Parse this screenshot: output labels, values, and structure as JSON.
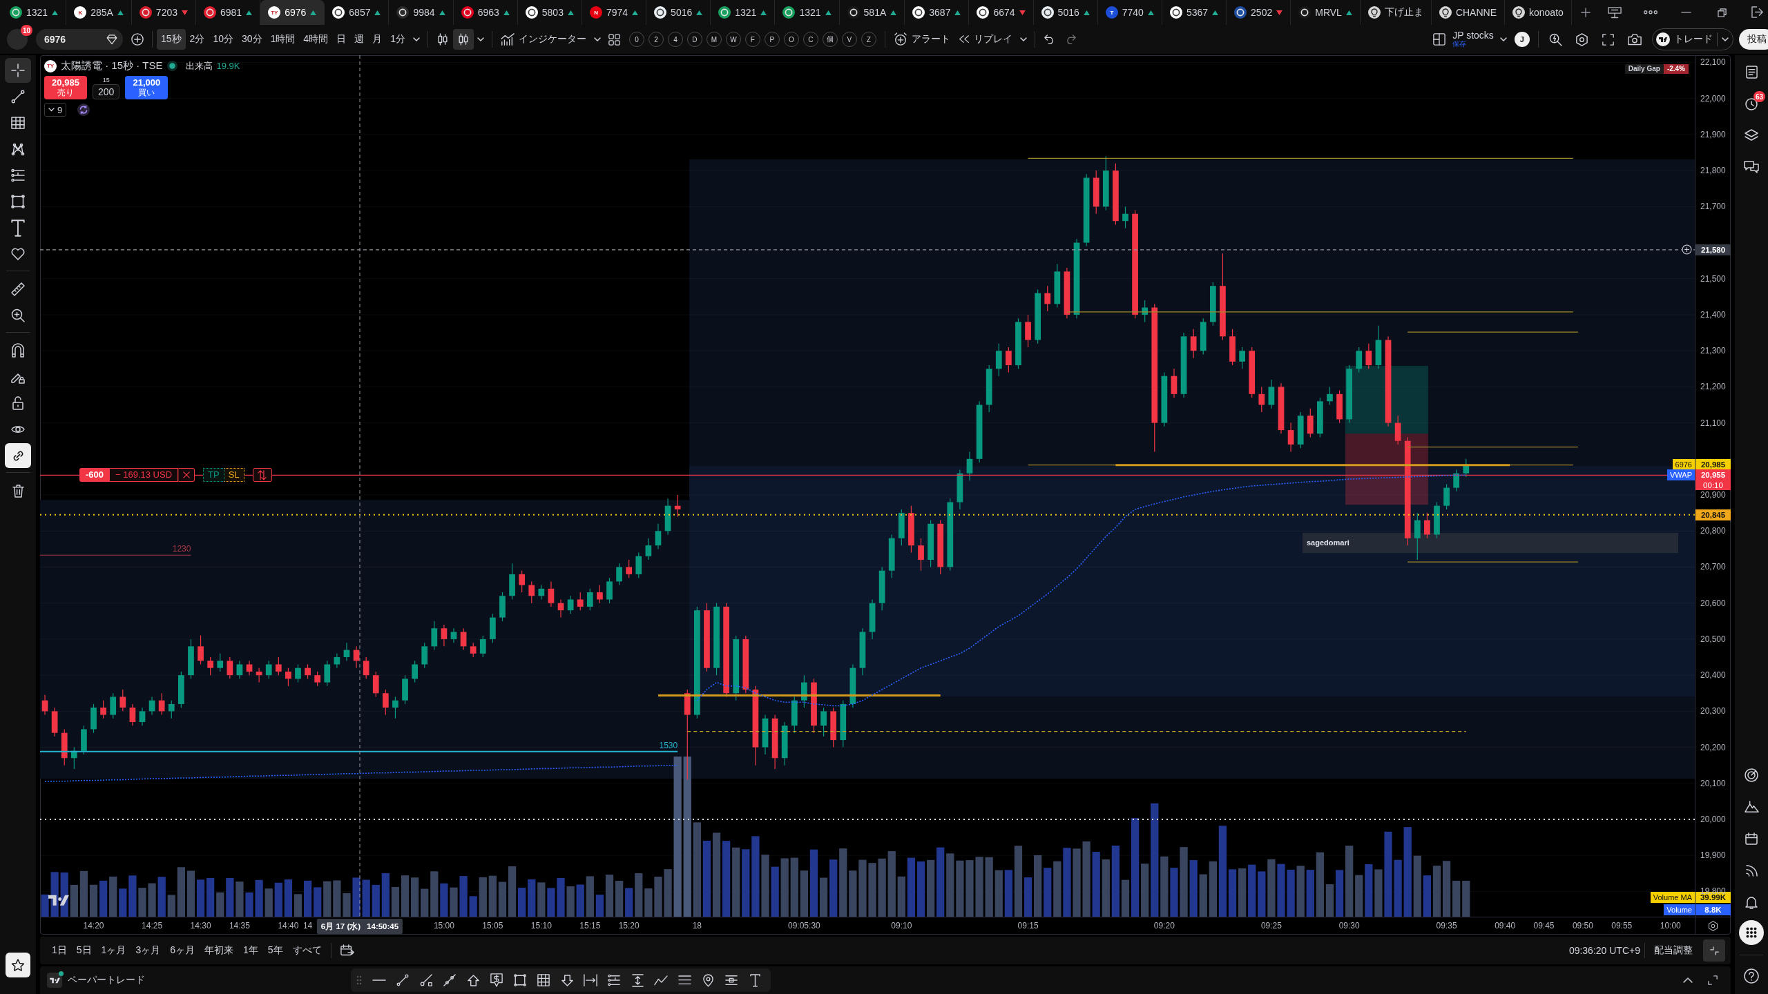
{
  "tabs": [
    {
      "kind": "symbol",
      "label": "1321",
      "rising": true,
      "color": "#18a05e",
      "selected": false
    },
    {
      "kind": "symbol",
      "label": "285A",
      "rising": true,
      "color": "#ffffff",
      "logo": "K",
      "selected": false
    },
    {
      "kind": "symbol",
      "label": "7203",
      "rising": false,
      "color": "#d81e2c",
      "selected": false
    },
    {
      "kind": "symbol",
      "label": "6981",
      "rising": true,
      "color": "#e0202f",
      "selected": false
    },
    {
      "kind": "symbol",
      "label": "6976",
      "rising": true,
      "color": "#ffffff",
      "logo": "TY",
      "selected": true
    },
    {
      "kind": "symbol",
      "label": "6857",
      "rising": true,
      "color": "#ffffff",
      "selected": false
    },
    {
      "kind": "symbol",
      "label": "9984",
      "rising": true,
      "color": "#2b2b2b",
      "selected": false
    },
    {
      "kind": "symbol",
      "label": "6963",
      "rising": true,
      "color": "#e00020",
      "selected": false
    },
    {
      "kind": "symbol",
      "label": "5803",
      "rising": true,
      "color": "#ffffff",
      "selected": false
    },
    {
      "kind": "symbol",
      "label": "7974",
      "rising": true,
      "color": "#e60012",
      "logo": "N",
      "selected": false
    },
    {
      "kind": "symbol",
      "label": "5016",
      "rising": true,
      "color": "#e8eef2",
      "selected": false
    },
    {
      "kind": "symbol",
      "label": "1321",
      "rising": true,
      "color": "#18a05e",
      "selected": false
    },
    {
      "kind": "symbol",
      "label": "1321",
      "rising": true,
      "color": "#18a05e",
      "selected": false
    },
    {
      "kind": "symbol",
      "label": "581A",
      "rising": true,
      "color": "#1a1a1a",
      "selected": false
    },
    {
      "kind": "symbol",
      "label": "3687",
      "rising": true,
      "color": "#ffffff",
      "selected": false
    },
    {
      "kind": "symbol",
      "label": "6674",
      "rising": false,
      "color": "#ffffff",
      "selected": false
    },
    {
      "kind": "symbol",
      "label": "5016",
      "rising": true,
      "color": "#e8eef2",
      "selected": false
    },
    {
      "kind": "symbol",
      "label": "7740",
      "rising": true,
      "color": "#1d4ed8",
      "logo": "T",
      "selected": false
    },
    {
      "kind": "symbol",
      "label": "5367",
      "rising": true,
      "color": "#ffffff",
      "selected": false
    },
    {
      "kind": "symbol",
      "label": "2502",
      "rising": false,
      "color": "#1f4fa0",
      "selected": false
    },
    {
      "kind": "symbol",
      "label": "MRVL",
      "rising": true,
      "color": "#1a1a1a",
      "selected": false
    },
    {
      "kind": "idea",
      "label": "下げ止ま",
      "selected": false
    },
    {
      "kind": "idea",
      "label": "CHANNE",
      "selected": false
    },
    {
      "kind": "idea",
      "label": "konoato",
      "selected": false
    }
  ],
  "toolbar": {
    "account_badge": "10",
    "symbol": "6976",
    "intervals": [
      {
        "label": "15秒",
        "selected": true
      },
      {
        "label": "2分",
        "selected": false
      },
      {
        "label": "10分",
        "selected": false
      },
      {
        "label": "30分",
        "selected": false
      },
      {
        "label": "1時間",
        "selected": false
      },
      {
        "label": "4時間",
        "selected": false
      },
      {
        "label": "日",
        "selected": false
      },
      {
        "label": "週",
        "selected": false
      },
      {
        "label": "月",
        "selected": false
      },
      {
        "label": "1分",
        "selected": false
      }
    ],
    "chart_types": [
      {
        "selected": false
      },
      {
        "selected": true
      }
    ],
    "indicators": "インジケーター",
    "quick_buttons": [
      "0",
      "2",
      "4",
      "D",
      "M",
      "W",
      "F",
      "P",
      "O",
      "C",
      "個",
      "V",
      "Z"
    ],
    "alert": "アラート",
    "replay": "リプレイ",
    "layout": {
      "name": "JP stocks",
      "status": "保存",
      "avatar": "J"
    },
    "trade": "トレード",
    "publish": "投稿"
  },
  "left_toolbar": {
    "drawing_tools": [
      {
        "selected": true
      },
      {
        "selected": false
      },
      {
        "selected": false
      },
      {
        "selected": false
      },
      {
        "selected": false
      },
      {
        "selected": false
      },
      {
        "selected": false
      },
      {
        "selected": false
      }
    ],
    "measure_tools": [
      {
        "selected": false
      },
      {
        "selected": false
      }
    ],
    "toggles": [
      {
        "on": false
      },
      {
        "on": false
      },
      {
        "on": false
      },
      {
        "on": false
      },
      {
        "on": true
      }
    ]
  },
  "right_sidebar": {
    "alerts_badge": "63",
    "top_panels": [
      {
        "selected": false
      },
      {
        "selected": false
      },
      {
        "selected": false
      },
      {
        "selected": false
      }
    ],
    "bottom_panels": [
      {
        "selected": false
      },
      {
        "selected": false
      },
      {
        "selected": false
      },
      {
        "selected": false
      },
      {
        "selected": false
      },
      {
        "selected": true
      }
    ]
  },
  "chart": {
    "legend": {
      "logo": "TY",
      "title": "太陽誘電 · 15秒 · TSE",
      "volume_label": "出来高",
      "volume_value": "19.9K"
    },
    "trade_buttons": {
      "sell_price": "20,985",
      "sell_label": "売り",
      "step": "15",
      "quantity": "200",
      "buy_price": "21,000",
      "buy_label": "買い"
    },
    "indicator_toggle": "9",
    "daily_gap": {
      "label": "Daily Gap",
      "value": "-2.4%"
    },
    "position": {
      "quantity": "-600",
      "pnl": "− 169.13 USD",
      "take_profit": "TP",
      "stop_loss": "SL"
    },
    "zone_label": "sagedomari",
    "level_labels": [
      "1230",
      "1530"
    ],
    "price_badges": [
      {
        "kind": "last",
        "tag": "6976",
        "price": "20,985"
      },
      {
        "kind": "vwap",
        "price": "20,955",
        "countdown": "00:10"
      },
      {
        "kind": "line",
        "price": "20,845"
      }
    ],
    "crosshair": {
      "date": "6月 17 (水)",
      "time": "14:50:45"
    },
    "volume_badges": [
      {
        "tag": "Volume MA",
        "value": "39.99K"
      },
      {
        "tag": "Volume",
        "value": "8.8K"
      }
    ],
    "chart_data": {
      "type": "candlestick",
      "grid": true,
      "ylim": [
        19730,
        22120
      ],
      "yticks": [
        {
          "value": 19800,
          "label": "19,800"
        },
        {
          "value": 19900,
          "label": "19,900"
        },
        {
          "value": 20000,
          "label": "20,000"
        },
        {
          "value": 20100,
          "label": "20,100"
        },
        {
          "value": 20200,
          "label": "20,200"
        },
        {
          "value": 20300,
          "label": "20,300"
        },
        {
          "value": 20400,
          "label": "20,400"
        },
        {
          "value": 20500,
          "label": "20,500"
        },
        {
          "value": 20600,
          "label": "20,600"
        },
        {
          "value": 20700,
          "label": "20,700"
        },
        {
          "value": 20800,
          "label": "20,800"
        },
        {
          "value": 20900,
          "label": "20,900"
        },
        {
          "value": 21100,
          "label": "21,100"
        },
        {
          "value": 21200,
          "label": "21,200"
        },
        {
          "value": 21300,
          "label": "21,300"
        },
        {
          "value": 21400,
          "label": "21,400"
        },
        {
          "value": 21500,
          "label": "21,500"
        },
        {
          "value": 21700,
          "label": "21,700"
        },
        {
          "value": 21800,
          "label": "21,800"
        },
        {
          "value": 21900,
          "label": "21,900"
        },
        {
          "value": 22000,
          "label": "22,000"
        },
        {
          "value": 22100,
          "label": "22,100"
        }
      ],
      "categories": [
        null,
        null,
        null,
        null,
        null,
        "14:20",
        null,
        null,
        null,
        null,
        null,
        "14:25",
        null,
        null,
        null,
        null,
        "14:30",
        null,
        null,
        null,
        "14:35",
        null,
        null,
        null,
        null,
        "14:40",
        null,
        "14",
        null,
        null,
        null,
        null,
        null,
        null,
        null,
        null,
        null,
        null,
        null,
        null,
        null,
        "15:00",
        null,
        null,
        null,
        null,
        "15:05",
        null,
        null,
        null,
        null,
        "15:10",
        null,
        null,
        null,
        null,
        "15:15",
        null,
        null,
        null,
        "15:20",
        null,
        null,
        null,
        null,
        null,
        null,
        "18",
        null,
        null,
        null,
        null,
        null,
        null,
        null,
        null,
        null,
        null,
        "09:05:30",
        null,
        null,
        null,
        null,
        null,
        null,
        null,
        null,
        null,
        "09:10",
        null,
        null,
        null,
        null,
        null,
        null,
        null,
        null,
        null,
        null,
        null,
        null,
        "09:15",
        null,
        null,
        null,
        null,
        null,
        null,
        null,
        null,
        null,
        null,
        null,
        null,
        null,
        "09:20",
        null,
        null,
        null,
        null,
        null,
        null,
        null,
        null,
        null,
        null,
        "09:25",
        null,
        null,
        null,
        null,
        null,
        null,
        null,
        "09:30",
        null,
        null,
        null,
        null,
        null,
        null,
        null,
        null,
        null,
        "09:35",
        null,
        null,
        null,
        null,
        null,
        "09:40",
        null,
        null,
        null,
        "09:45",
        null,
        null,
        null,
        "09:50",
        null,
        null,
        null,
        "09:55",
        null,
        null,
        null,
        null,
        "10:00",
        null,
        null
      ],
      "ohlc": [
        [
          20330,
          20345,
          20290,
          20300
        ],
        [
          20300,
          20310,
          20230,
          20240
        ],
        [
          20240,
          20250,
          20150,
          20170
        ],
        [
          20170,
          20200,
          20140,
          20190
        ],
        [
          20190,
          20260,
          20180,
          20250
        ],
        [
          20250,
          20320,
          20240,
          20310
        ],
        [
          20310,
          20330,
          20280,
          20290
        ],
        [
          20290,
          20350,
          20280,
          20340
        ],
        [
          20340,
          20360,
          20300,
          20310
        ],
        [
          20310,
          20320,
          20260,
          20270
        ],
        [
          20270,
          20310,
          20260,
          20300
        ],
        [
          20300,
          20340,
          20290,
          20330
        ],
        [
          20330,
          20350,
          20290,
          20300
        ],
        [
          20300,
          20330,
          20280,
          20320
        ],
        [
          20320,
          20410,
          20310,
          20400
        ],
        [
          20400,
          20500,
          20390,
          20480
        ],
        [
          20480,
          20510,
          20430,
          20440
        ],
        [
          20440,
          20450,
          20400,
          20420
        ],
        [
          20420,
          20460,
          20410,
          20440
        ],
        [
          20440,
          20450,
          20390,
          20400
        ],
        [
          20400,
          20440,
          20390,
          20430
        ],
        [
          20430,
          20440,
          20400,
          20410
        ],
        [
          20410,
          20420,
          20380,
          20400
        ],
        [
          20400,
          20440,
          20390,
          20430
        ],
        [
          20430,
          20450,
          20400,
          20410
        ],
        [
          20410,
          20420,
          20370,
          20390
        ],
        [
          20390,
          20430,
          20380,
          20420
        ],
        [
          20420,
          20430,
          20390,
          20400
        ],
        [
          20400,
          20410,
          20370,
          20380
        ],
        [
          20380,
          20440,
          20370,
          20430
        ],
        [
          20430,
          20460,
          20420,
          20450
        ],
        [
          20450,
          20490,
          20440,
          20470
        ],
        [
          20470,
          20480,
          20420,
          20440
        ],
        [
          20440,
          20450,
          20390,
          20400
        ],
        [
          20400,
          20410,
          20340,
          20350
        ],
        [
          20350,
          20360,
          20290,
          20310
        ],
        [
          20310,
          20340,
          20280,
          20330
        ],
        [
          20330,
          20400,
          20320,
          20390
        ],
        [
          20390,
          20440,
          20380,
          20430
        ],
        [
          20430,
          20490,
          20420,
          20480
        ],
        [
          20480,
          20550,
          20470,
          20530
        ],
        [
          20530,
          20540,
          20480,
          20500
        ],
        [
          20500,
          20530,
          20490,
          20520
        ],
        [
          20520,
          20530,
          20470,
          20480
        ],
        [
          20480,
          20490,
          20450,
          20460
        ],
        [
          20460,
          20510,
          20450,
          20500
        ],
        [
          20500,
          20570,
          20490,
          20560
        ],
        [
          20560,
          20630,
          20550,
          20620
        ],
        [
          20620,
          20710,
          20610,
          20680
        ],
        [
          20680,
          20690,
          20630,
          20650
        ],
        [
          20650,
          20660,
          20600,
          20620
        ],
        [
          20620,
          20650,
          20610,
          20640
        ],
        [
          20640,
          20660,
          20590,
          20600
        ],
        [
          20600,
          20610,
          20560,
          20580
        ],
        [
          20580,
          20620,
          20570,
          20610
        ],
        [
          20610,
          20630,
          20580,
          20590
        ],
        [
          20590,
          20640,
          20580,
          20630
        ],
        [
          20630,
          20650,
          20600,
          20610
        ],
        [
          20610,
          20670,
          20600,
          20660
        ],
        [
          20660,
          20710,
          20650,
          20700
        ],
        [
          20700,
          20720,
          20670,
          20680
        ],
        [
          20680,
          20740,
          20670,
          20730
        ],
        [
          20730,
          20780,
          20720,
          20760
        ],
        [
          20760,
          20820,
          20750,
          20800
        ],
        [
          20800,
          20890,
          20790,
          20870
        ],
        [
          20870,
          20900,
          20840,
          20860
        ],
        [
          20350,
          20360,
          20110,
          20290
        ],
        [
          20290,
          20590,
          20280,
          20580
        ],
        [
          20580,
          20600,
          20410,
          20420
        ],
        [
          20420,
          20600,
          20400,
          20590
        ],
        [
          20590,
          20600,
          20340,
          20350
        ],
        [
          20350,
          20510,
          20330,
          20500
        ],
        [
          20500,
          20510,
          20350,
          20360
        ],
        [
          20360,
          20370,
          20150,
          20200
        ],
        [
          20200,
          20290,
          20180,
          20280
        ],
        [
          20280,
          20290,
          20140,
          20170
        ],
        [
          20170,
          20270,
          20150,
          20260
        ],
        [
          20260,
          20340,
          20240,
          20330
        ],
        [
          20330,
          20400,
          20310,
          20380
        ],
        [
          20380,
          20390,
          20240,
          20260
        ],
        [
          20260,
          20310,
          20230,
          20300
        ],
        [
          20300,
          20310,
          20200,
          20220
        ],
        [
          20220,
          20330,
          20200,
          20320
        ],
        [
          20320,
          20430,
          20310,
          20420
        ],
        [
          20420,
          20530,
          20400,
          20520
        ],
        [
          20520,
          20610,
          20500,
          20600
        ],
        [
          20600,
          20700,
          20580,
          20690
        ],
        [
          20690,
          20790,
          20670,
          20780
        ],
        [
          20780,
          20860,
          20760,
          20850
        ],
        [
          20850,
          20870,
          20740,
          20760
        ],
        [
          20760,
          20780,
          20690,
          20720
        ],
        [
          20720,
          20830,
          20700,
          20820
        ],
        [
          20820,
          20830,
          20680,
          20700
        ],
        [
          20700,
          20890,
          20690,
          20880
        ],
        [
          20880,
          20970,
          20860,
          20960
        ],
        [
          20960,
          21020,
          20940,
          21000
        ],
        [
          21000,
          21160,
          20990,
          21150
        ],
        [
          21150,
          21260,
          21130,
          21250
        ],
        [
          21250,
          21320,
          21230,
          21300
        ],
        [
          21300,
          21310,
          21240,
          21260
        ],
        [
          21260,
          21390,
          21250,
          21380
        ],
        [
          21380,
          21400,
          21310,
          21330
        ],
        [
          21330,
          21470,
          21320,
          21460
        ],
        [
          21460,
          21480,
          21410,
          21430
        ],
        [
          21430,
          21540,
          21420,
          21520
        ],
        [
          21520,
          21530,
          21390,
          21400
        ],
        [
          21400,
          21610,
          21390,
          21600
        ],
        [
          21600,
          21790,
          21590,
          21780
        ],
        [
          21780,
          21800,
          21680,
          21700
        ],
        [
          21700,
          21840,
          21690,
          21800
        ],
        [
          21800,
          21820,
          21650,
          21660
        ],
        [
          21660,
          21700,
          21640,
          21680
        ],
        [
          21680,
          21690,
          21390,
          21400
        ],
        [
          21400,
          21440,
          21380,
          21420
        ],
        [
          21420,
          21430,
          21020,
          21100
        ],
        [
          21100,
          21240,
          21090,
          21230
        ],
        [
          21230,
          21250,
          21170,
          21180
        ],
        [
          21180,
          21350,
          21170,
          21340
        ],
        [
          21340,
          21360,
          21280,
          21300
        ],
        [
          21300,
          21390,
          21290,
          21380
        ],
        [
          21380,
          21490,
          21370,
          21480
        ],
        [
          21480,
          21570,
          21330,
          21340
        ],
        [
          21340,
          21360,
          21260,
          21270
        ],
        [
          21270,
          21310,
          21250,
          21300
        ],
        [
          21300,
          21310,
          21170,
          21180
        ],
        [
          21180,
          21200,
          21130,
          21150
        ],
        [
          21150,
          21220,
          21140,
          21200
        ],
        [
          21200,
          21210,
          21070,
          21080
        ],
        [
          21080,
          21100,
          21020,
          21040
        ],
        [
          21040,
          21130,
          21030,
          21120
        ],
        [
          21120,
          21140,
          21060,
          21070
        ],
        [
          21070,
          21170,
          21060,
          21160
        ],
        [
          21160,
          21200,
          21150,
          21180
        ],
        [
          21180,
          21190,
          21100,
          21110
        ],
        [
          21110,
          21260,
          21100,
          21250
        ],
        [
          21250,
          21310,
          21240,
          21300
        ],
        [
          21300,
          21320,
          21250,
          21260
        ],
        [
          21260,
          21370,
          21250,
          21330
        ],
        [
          21330,
          21340,
          21090,
          21100
        ],
        [
          21100,
          21120,
          21040,
          21050
        ],
        [
          21050,
          21060,
          20760,
          20780
        ],
        [
          20780,
          20850,
          20720,
          20830
        ],
        [
          20830,
          20850,
          20780,
          20790
        ],
        [
          20790,
          20880,
          20780,
          20870
        ],
        [
          20870,
          20930,
          20860,
          20920
        ],
        [
          20920,
          20970,
          20910,
          20960
        ],
        [
          20960,
          21000,
          20950,
          20985
        ],
        null,
        null,
        null,
        null,
        null,
        null,
        null,
        null,
        null,
        null,
        null,
        null,
        null,
        null,
        null,
        null,
        null,
        null,
        null,
        null,
        null,
        null,
        null
      ],
      "series": [
        {
          "name": "VWAP",
          "type": "line",
          "color": "#2962ff",
          "line_style": "dotted",
          "values": [
            20105,
            20106,
            20106,
            20107,
            20108,
            20108,
            20109,
            20110,
            20110,
            20111,
            20112,
            20113,
            20113,
            20114,
            20115,
            20115,
            20116,
            20117,
            20117,
            20118,
            20119,
            20120,
            20120,
            20121,
            20122,
            20122,
            20123,
            20124,
            20124,
            20125,
            20126,
            20127,
            20127,
            20128,
            20129,
            20129,
            20130,
            20131,
            20131,
            20132,
            20133,
            20134,
            20134,
            20135,
            20136,
            20136,
            20137,
            20138,
            20138,
            20139,
            20140,
            20141,
            20141,
            20142,
            20143,
            20143,
            20144,
            20145,
            20145,
            20146,
            20147,
            20148,
            20148,
            20149,
            20150,
            20150,
            null,
            20330,
            20360,
            20380,
            20370,
            20370,
            20365,
            20350,
            20340,
            20330,
            20325,
            20325,
            20325,
            20320,
            20318,
            20315,
            20315,
            20320,
            20330,
            20345,
            20360,
            20375,
            20390,
            20405,
            20420,
            20430,
            20440,
            20450,
            20460,
            20475,
            20495,
            20515,
            20535,
            20550,
            20565,
            20585,
            20605,
            20625,
            20648,
            20670,
            20695,
            20725,
            20755,
            20785,
            20810,
            20840,
            20860,
            20868,
            20875,
            20882,
            20888,
            20895,
            20900,
            20905,
            20910,
            20914,
            20918,
            20922,
            20925,
            20927,
            20929,
            20931,
            20933,
            20935,
            20937,
            20938,
            20940,
            20942,
            20944,
            20945,
            20946,
            20947,
            20948,
            20949,
            20950,
            20951,
            20952,
            20953,
            20954,
            20955,
            20955,
            null,
            null,
            null,
            null,
            null,
            null,
            null,
            null,
            null,
            null,
            null,
            null,
            null,
            null,
            null,
            null,
            null,
            null,
            null,
            null,
            null,
            null,
            null
          ]
        }
      ],
      "ref_lines": [
        {
          "axis": "y",
          "value": 20955,
          "color": "#f23645",
          "line_style": "solid"
        },
        {
          "axis": "y",
          "value": 20845,
          "color": "#f5c518",
          "line_style": "dotted"
        },
        {
          "axis": "y",
          "value": 20000,
          "color": "#e0e3eb",
          "line_style": "dotted"
        },
        {
          "axis": "y",
          "value": 21580,
          "label": "21,580",
          "color": "#9598a1",
          "line_style": "dashed"
        },
        {
          "axis": "y",
          "value": 21834,
          "color": "#a08a2a",
          "line_style": "solid"
        },
        {
          "axis": "y",
          "value": 21408,
          "color": "#a08a2a",
          "line_style": "solid"
        },
        {
          "axis": "y",
          "value": 21352,
          "color": "#a08a2a",
          "line_style": "solid"
        },
        {
          "axis": "y",
          "value": 21033,
          "color": "#a08a2a",
          "line_style": "solid"
        },
        {
          "axis": "y",
          "value": 20983,
          "color": "#a08a2a",
          "line_style": "solid"
        },
        {
          "axis": "y",
          "value": 20983,
          "color": "#d39a1c",
          "line_style": "solid"
        },
        {
          "axis": "y",
          "value": 20714,
          "color": "#a08a2a",
          "line_style": "solid"
        },
        {
          "axis": "y",
          "value": 20344,
          "color": "#d39a1c",
          "line_style": "solid"
        },
        {
          "axis": "y",
          "value": 20244,
          "color": "#c9a227",
          "line_style": "dashed"
        },
        {
          "axis": "y",
          "value": 20733,
          "color": "#a83a44",
          "line_style": "solid"
        },
        {
          "axis": "y",
          "value": 20188,
          "color": "#26b5d0",
          "line_style": "solid"
        }
      ]
    }
  },
  "range_bar": {
    "ranges": [
      "1日",
      "5日",
      "1ヶ月",
      "3ヶ月",
      "6ヶ月",
      "年初来",
      "1年",
      "5年",
      "すべて"
    ],
    "clock": "09:36:20 UTC+9",
    "adjustment": "配当調整"
  },
  "bottom_panel": {
    "title": "ペーパートレード"
  }
}
